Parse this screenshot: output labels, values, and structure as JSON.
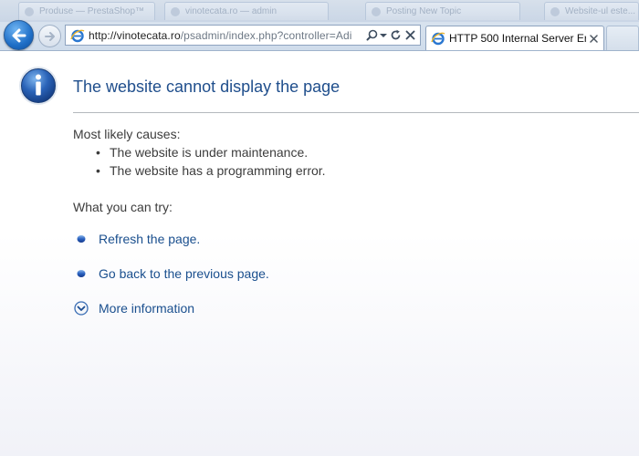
{
  "browser": {
    "background_tabs": [
      {
        "label": "Produse — PrestaShop™"
      },
      {
        "label": "vinotecata.ro — admin"
      },
      {
        "label": "Posting New Topic"
      },
      {
        "label": "Website-ul este..."
      }
    ],
    "address_bar": {
      "url_host": "http://vinotecata.ro",
      "url_path": "/psadmin/index.php?controller=Adi"
    },
    "active_tab": {
      "title": "HTTP 500 Internal Server Err..."
    },
    "icons": {
      "back": "back-arrow-icon",
      "forward": "forward-arrow-icon",
      "search": "search-icon",
      "dropdown": "chevron-down-icon",
      "refresh": "refresh-icon",
      "stop": "close-icon",
      "tab_close": "close-icon",
      "page": "info-icon"
    }
  },
  "error_page": {
    "title": "The website cannot display the page",
    "causes_heading": "Most likely causes:",
    "causes": [
      "The website is under maintenance.",
      "The website has a programming error."
    ],
    "try_heading": "What you can try:",
    "actions": [
      {
        "label": "Refresh the page."
      },
      {
        "label": "Go back to the previous page."
      }
    ],
    "more_info": "More information"
  },
  "colors": {
    "title_blue": "#1f4e8c",
    "link_blue": "#1a4f8e",
    "body_text": "#3c3c3c",
    "rule": "#b4b8bd"
  }
}
